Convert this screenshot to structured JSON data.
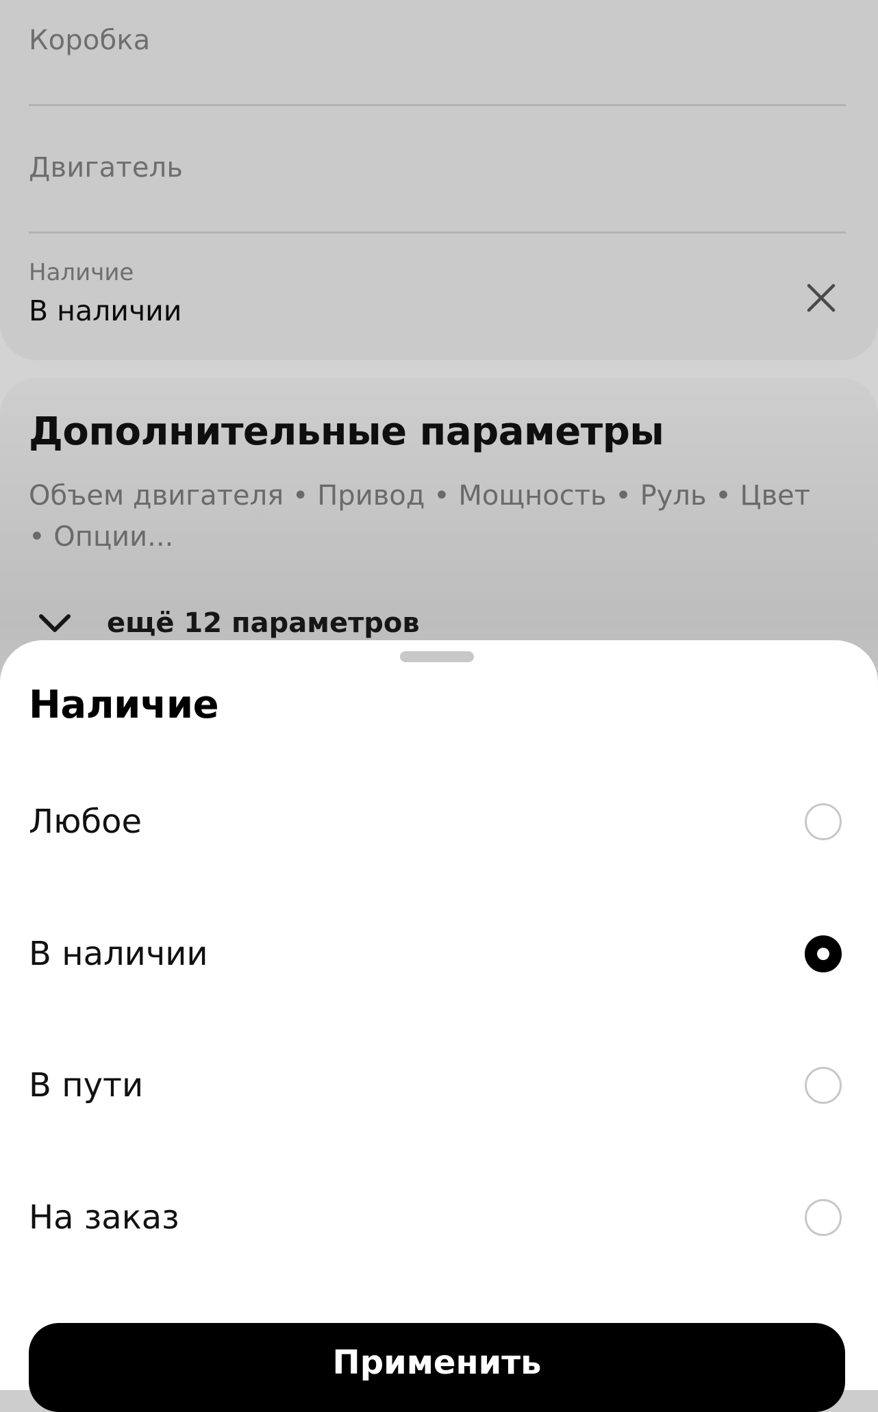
{
  "filters": {
    "fields": [
      {
        "placeholder": "Коробка"
      },
      {
        "placeholder": "Двигатель"
      }
    ],
    "availability": {
      "label": "Наличие",
      "value": "В наличии"
    }
  },
  "extra": {
    "title": "Дополнительные параметры",
    "subtitle": "Объем двигателя • Привод • Мощность • Руль • Цвет • Опции...",
    "more_label": "ещё 12 параметров"
  },
  "sheet": {
    "title": "Наличие",
    "options": [
      {
        "label": "Любое",
        "selected": false
      },
      {
        "label": "В наличии",
        "selected": true
      },
      {
        "label": "В пути",
        "selected": false
      },
      {
        "label": "На заказ",
        "selected": false
      }
    ],
    "apply_label": "Применить"
  },
  "icons": {
    "clear": "close-icon",
    "expand": "chevron-down-icon"
  },
  "colors": {
    "accent": "#000000",
    "overlay": "#cdcdcd",
    "sheet_bg": "#ffffff"
  }
}
